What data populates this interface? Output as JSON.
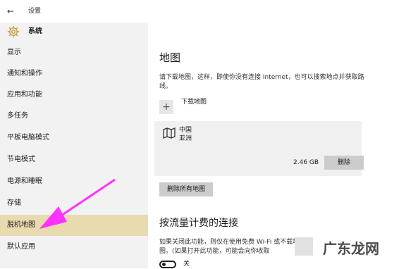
{
  "titlebar": {
    "back_glyph": "←",
    "title": "设置"
  },
  "header": {
    "icon": "gear-icon",
    "label": "系统"
  },
  "sidebar": {
    "selected_index": 8,
    "items": [
      {
        "label": "显示"
      },
      {
        "label": "通知和操作"
      },
      {
        "label": "应用和功能"
      },
      {
        "label": "多任务"
      },
      {
        "label": "平板电脑模式"
      },
      {
        "label": "节电模式"
      },
      {
        "label": "电源和睡眠"
      },
      {
        "label": "存储"
      },
      {
        "label": "脱机地图"
      },
      {
        "label": "默认应用"
      }
    ]
  },
  "main": {
    "heading": "地图",
    "description": "请下载地图，这样，即使你没有连接 Internet，也可以搜索地点并获取路线。",
    "download": {
      "plus_glyph": "+",
      "label": "下载地图"
    },
    "map_entry": {
      "icon": "map-icon",
      "name": "中国",
      "region": "亚洲",
      "size": "2.46 GB",
      "delete_label": "删除"
    },
    "delete_all_label": "删除所有地图",
    "metered_heading": "按流量计费的连接",
    "metered_description": "如果关闭此功能，则仅在使用免费 Wi-Fi 或不载地图。(如果打开此功能，可能会向你收取",
    "toggle": {
      "state": "off",
      "label": "关"
    }
  },
  "watermark": {
    "text": "广东龙网"
  },
  "colors": {
    "sidebar_bg": "#f2f2f2",
    "selected_bg": "#e9dab0",
    "arrow": "#ff33ff",
    "button_bg": "#cccccc"
  }
}
